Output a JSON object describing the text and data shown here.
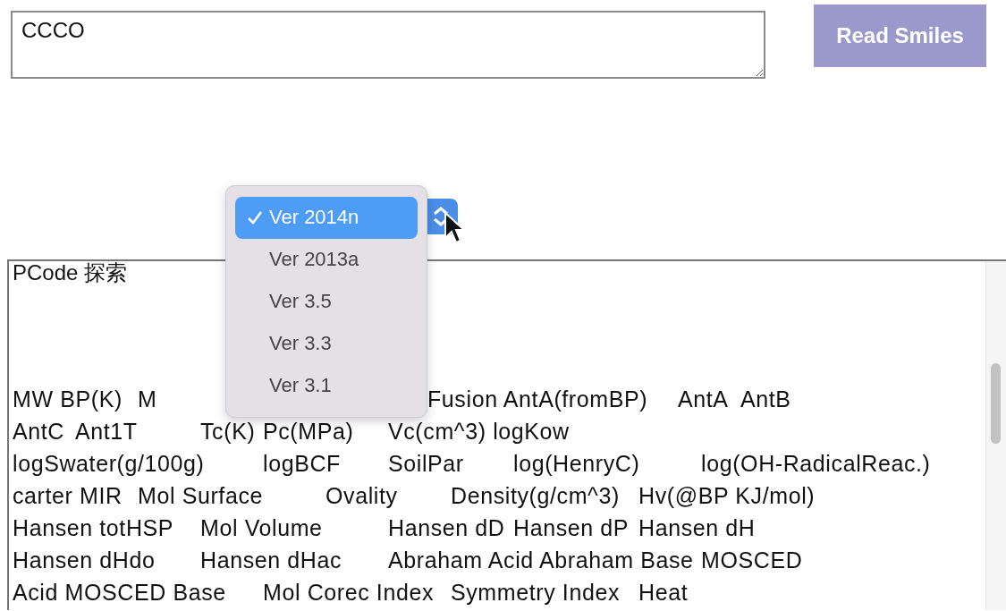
{
  "smiles_field": {
    "value": "CCCO"
  },
  "read_button": {
    "label": "Read Smiles"
  },
  "version_select": {
    "options": [
      {
        "label": "Ver 2014n",
        "selected": true
      },
      {
        "label": "Ver 2013a",
        "selected": false
      },
      {
        "label": "Ver 3.5",
        "selected": false
      },
      {
        "label": "Ver 3.3",
        "selected": false
      },
      {
        "label": "Ver 3.1",
        "selected": false
      }
    ]
  },
  "output": {
    "title": "PCode 探索",
    "lines": [
      {
        "parts": [
          "MW BP(K)\tM",
          "Fusion AntA(fromBP)\tAntA\tAntB"
        ]
      },
      {
        "parts": [
          "AntC\tAnt1T\tTc(K)\tPc(MPa)\tVc(cm^3) logKow"
        ]
      },
      {
        "parts": [
          "logSwater(g/100g)\tlogBCF\tSoilPar\tlog(HenryC)\tlog(OH-RadicalReac.)"
        ]
      },
      {
        "parts": [
          "carter MIR\tMol Surface\tOvality\tDensity(g/cm^3)\tHv(@BP KJ/mol)"
        ]
      },
      {
        "parts": [
          "Hansen totHSP\tMol Volume\tHansen dD\tHansen dP\tHansen dH"
        ]
      },
      {
        "parts": [
          "Hansen dHdo\tHansen dHac\tAbraham Acid Abraham Base\tMOSCED"
        ]
      },
      {
        "parts": [
          "Acid MOSCED Base\tMol Corec Index\tSymmetry Index\tHeat"
        ]
      }
    ]
  }
}
